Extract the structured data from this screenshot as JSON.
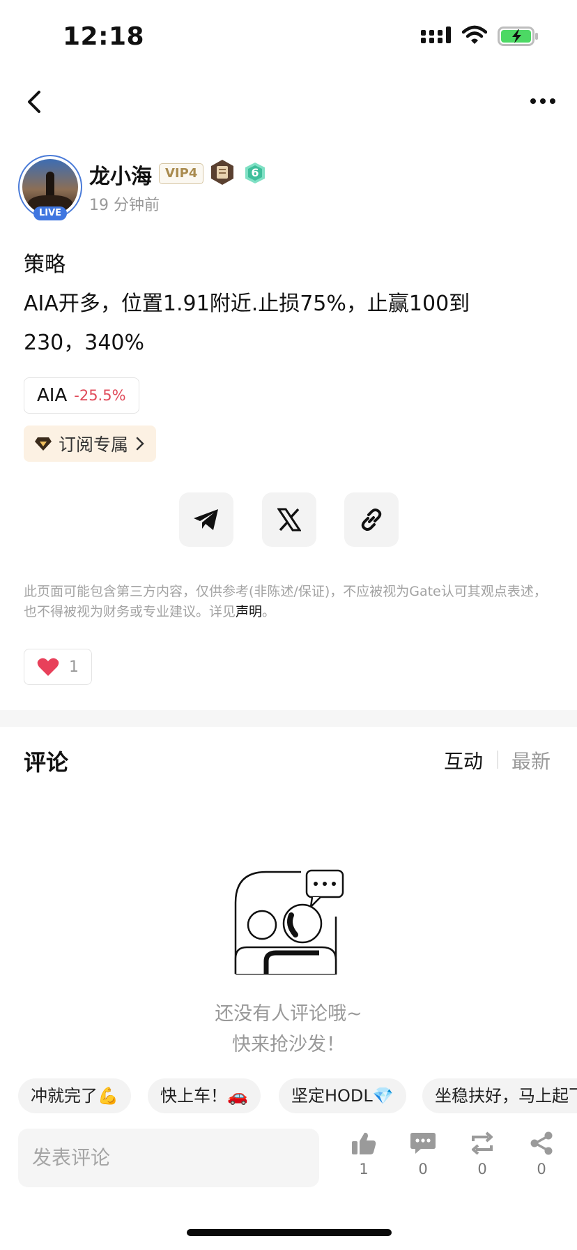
{
  "status_bar": {
    "time": "12:18"
  },
  "author": {
    "name": "龙小海",
    "vip": "VIP4",
    "level_badge": "6",
    "live_label": "LIVE",
    "posted": "19 分钟前"
  },
  "post": {
    "lines": [
      "策略",
      "AIA开多，位置1.91附近.止损75%，止赢100到",
      "230，340%"
    ]
  },
  "token_tag": {
    "symbol": "AIA",
    "change": "-25.5%"
  },
  "subscribe": {
    "label": "订阅专属"
  },
  "share": {
    "icons": [
      "telegram-icon",
      "x-icon",
      "link-icon"
    ]
  },
  "disclaimer": {
    "text": "此页面可能包含第三方内容，仅供参考(非陈述/保证)，不应被视为Gate认可其观点表述，也不得被视为财务或专业建议。详见",
    "link": "声明",
    "end": "。"
  },
  "likes": {
    "count": "1"
  },
  "comments": {
    "title": "评论",
    "sort_active": "互动",
    "sort_other": "最新",
    "empty_line1": "还没有人评论哦~",
    "empty_line2": "快来抢沙发！"
  },
  "quick_replies": [
    "冲就完了💪",
    "快上车！🚗",
    "坚定HODL💎",
    "坐稳扶好，马上起飞"
  ],
  "bottom_bar": {
    "placeholder": "发表评论",
    "like_count": "1",
    "comment_count": "0",
    "repost_count": "0",
    "share_count": "0"
  },
  "colors": {
    "negative": "#e04b5a",
    "accent_blue": "#3f76e0",
    "heart": "#e8405a"
  }
}
